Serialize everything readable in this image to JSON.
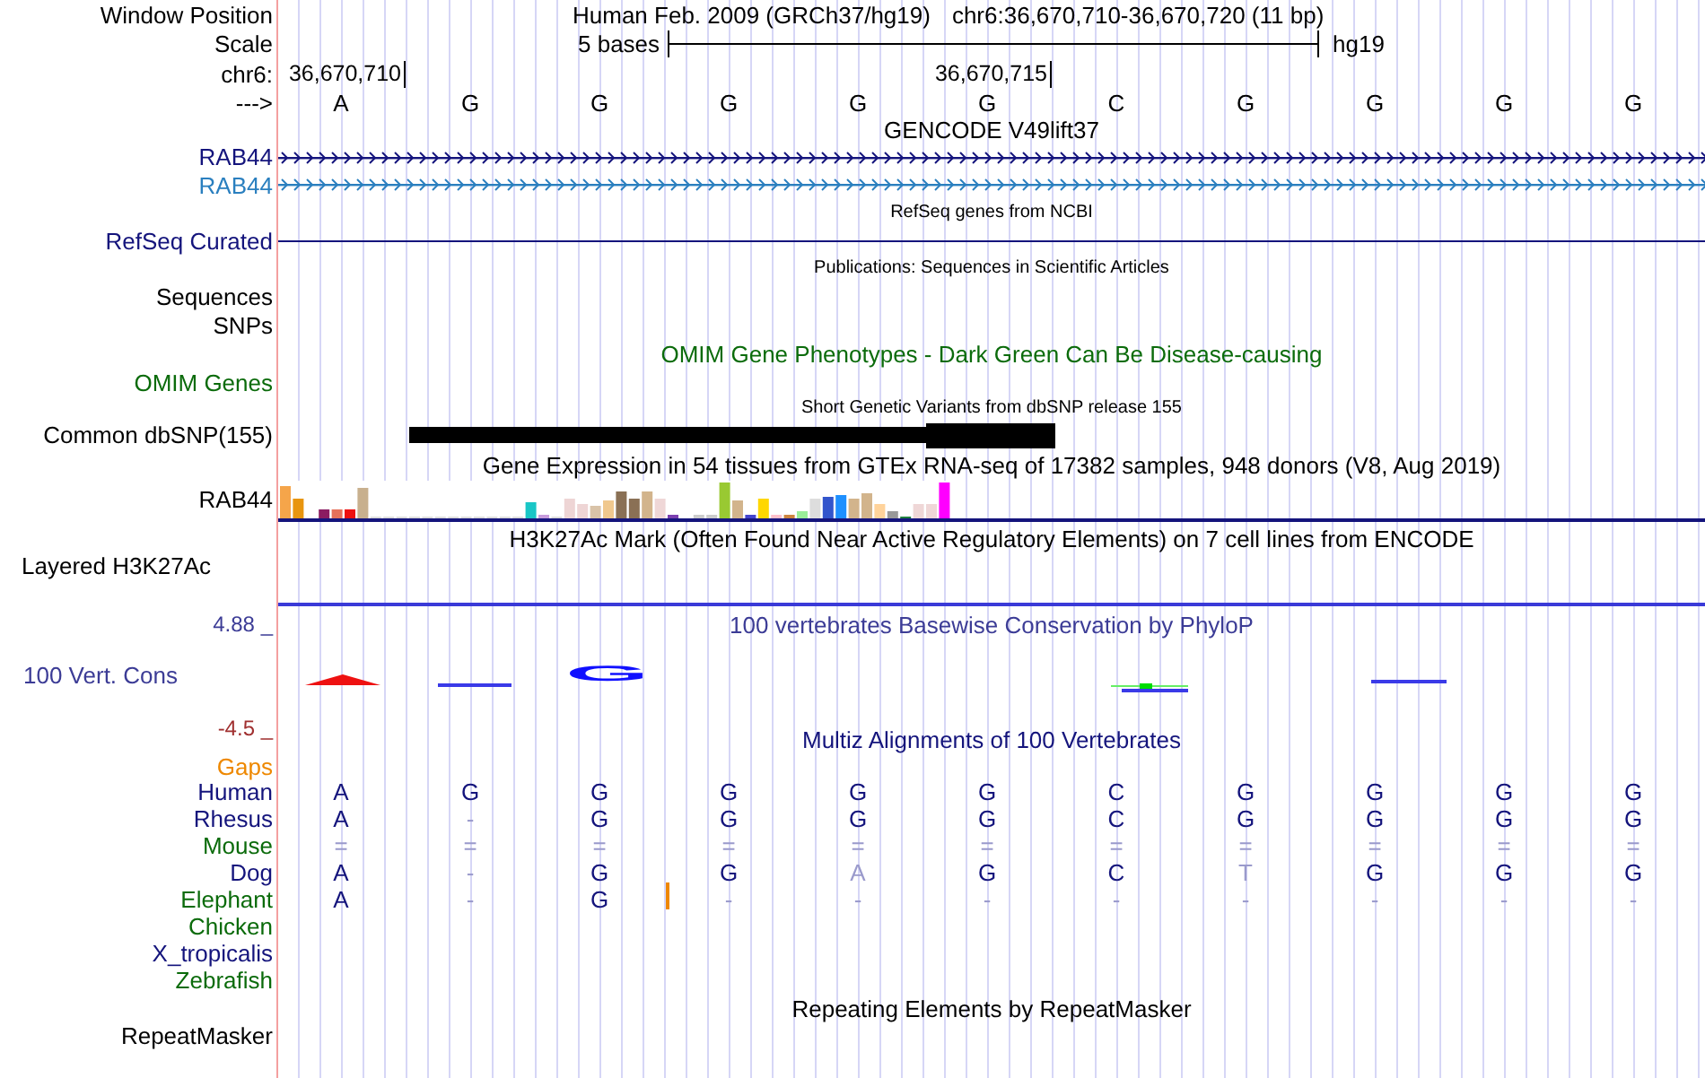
{
  "header": {
    "window_position_label": "Window Position",
    "title": "Human Feb. 2009 (GRCh37/hg19)",
    "position": "chr6:36,670,710-36,670,720 (11 bp)",
    "scale_label": "Scale",
    "scale_text": "5 bases",
    "scale_assembly": "hg19",
    "chrom_label": "chr6:",
    "ticks": [
      "36,670,710",
      "36,670,715"
    ],
    "strand_label": "--->",
    "bases": [
      "A",
      "G",
      "G",
      "G",
      "G",
      "G",
      "C",
      "G",
      "G",
      "G",
      "G"
    ]
  },
  "tracks": [
    {
      "kind": "genes",
      "title": "GENCODE V49lift37",
      "color": "#000000",
      "genes": [
        {
          "label": "RAB44",
          "color": "#14147c"
        },
        {
          "label": "RAB44",
          "color": "#2a7fbf"
        }
      ]
    },
    {
      "kind": "refseq",
      "title": "RefSeq genes from NCBI",
      "color": "#000000",
      "label": "RefSeq Curated",
      "gene_line": {
        "color": "#14147c"
      }
    },
    {
      "kind": "labels",
      "title": "Publications: Sequences in Scientific Articles",
      "color": "#000000",
      "labels": [
        "Sequences",
        "SNPs"
      ]
    },
    {
      "kind": "omim",
      "title": "OMIM Gene Phenotypes - Dark Green Can Be Disease-causing",
      "color": "#0b6b0b",
      "label": "OMIM Genes"
    },
    {
      "kind": "dbsnp",
      "title": "Short Genetic Variants from dbSNP release 155",
      "color": "#000000",
      "label": "Common dbSNP(155)"
    },
    {
      "kind": "gtex",
      "title": "Gene Expression in 54 tissues from GTEx RNA-seq of 17382 samples, 948 donors (V8, Aug 2019)",
      "color": "#000000",
      "label": "RAB44"
    },
    {
      "kind": "h3k27ac",
      "title": "H3K27Ac Mark (Often Found Near Active Regulatory Elements) on 7 cell lines from ENCODE",
      "color": "#000000",
      "label": "Layered H3K27Ac"
    },
    {
      "kind": "phylop",
      "title": "100 vertebrates Basewise Conservation by PhyloP",
      "color": "#3c3c96",
      "label": "100 Vert. Cons",
      "max": "4.88 _",
      "min": "-4.5 _",
      "logo_base": "G"
    },
    {
      "kind": "multiz",
      "title": "Multiz Alignments of 100 Vertebrates",
      "color": "#14147c",
      "gaps_label": "Gaps",
      "species": [
        {
          "name": "Human",
          "color": "#14147c",
          "bases": [
            {
              "text": "A",
              "faded": false,
              "insertion": false
            },
            {
              "text": "G",
              "faded": false,
              "insertion": false
            },
            {
              "text": "G",
              "faded": false,
              "insertion": false
            },
            {
              "text": "G",
              "faded": false,
              "insertion": false
            },
            {
              "text": "G",
              "faded": false,
              "insertion": false
            },
            {
              "text": "G",
              "faded": false,
              "insertion": false
            },
            {
              "text": "C",
              "faded": false,
              "insertion": false
            },
            {
              "text": "G",
              "faded": false,
              "insertion": false
            },
            {
              "text": "G",
              "faded": false,
              "insertion": false
            },
            {
              "text": "G",
              "faded": false,
              "insertion": false
            },
            {
              "text": "G",
              "faded": false,
              "insertion": false
            }
          ]
        },
        {
          "name": "Rhesus",
          "color": "#14147c",
          "bases": [
            {
              "text": "A",
              "faded": false,
              "insertion": false
            },
            {
              "text": "-",
              "faded": true,
              "insertion": false
            },
            {
              "text": "G",
              "faded": false,
              "insertion": false
            },
            {
              "text": "G",
              "faded": false,
              "insertion": false
            },
            {
              "text": "G",
              "faded": false,
              "insertion": false
            },
            {
              "text": "G",
              "faded": false,
              "insertion": false
            },
            {
              "text": "C",
              "faded": false,
              "insertion": false
            },
            {
              "text": "G",
              "faded": false,
              "insertion": false
            },
            {
              "text": "G",
              "faded": false,
              "insertion": false
            },
            {
              "text": "G",
              "faded": false,
              "insertion": false
            },
            {
              "text": "G",
              "faded": false,
              "insertion": false
            }
          ]
        },
        {
          "name": "Mouse",
          "color": "#0b6b0b",
          "bases": [
            {
              "text": "=",
              "faded": true,
              "insertion": false
            },
            {
              "text": "=",
              "faded": true,
              "insertion": false
            },
            {
              "text": "=",
              "faded": true,
              "insertion": false
            },
            {
              "text": "=",
              "faded": true,
              "insertion": false
            },
            {
              "text": "=",
              "faded": true,
              "insertion": false
            },
            {
              "text": "=",
              "faded": true,
              "insertion": false
            },
            {
              "text": "=",
              "faded": true,
              "insertion": false
            },
            {
              "text": "=",
              "faded": true,
              "insertion": false
            },
            {
              "text": "=",
              "faded": true,
              "insertion": false
            },
            {
              "text": "=",
              "faded": true,
              "insertion": false
            },
            {
              "text": "=",
              "faded": true,
              "insertion": false
            }
          ]
        },
        {
          "name": "Dog",
          "color": "#14147c",
          "bases": [
            {
              "text": "A",
              "faded": false,
              "insertion": false
            },
            {
              "text": "-",
              "faded": true,
              "insertion": false
            },
            {
              "text": "G",
              "faded": false,
              "insertion": false
            },
            {
              "text": "G",
              "faded": false,
              "insertion": false
            },
            {
              "text": "A",
              "faded": true,
              "insertion": false
            },
            {
              "text": "G",
              "faded": false,
              "insertion": false
            },
            {
              "text": "C",
              "faded": false,
              "insertion": false
            },
            {
              "text": "T",
              "faded": true,
              "insertion": false
            },
            {
              "text": "G",
              "faded": false,
              "insertion": false
            },
            {
              "text": "G",
              "faded": false,
              "insertion": false
            },
            {
              "text": "G",
              "faded": false,
              "insertion": false
            }
          ]
        },
        {
          "name": "Elephant",
          "color": "#0b6b0b",
          "bases": [
            {
              "text": "A",
              "faded": false,
              "insertion": false
            },
            {
              "text": "-",
              "faded": true,
              "insertion": false
            },
            {
              "text": "G",
              "faded": false,
              "insertion": true
            },
            {
              "text": "-",
              "faded": true,
              "insertion": false
            },
            {
              "text": "-",
              "faded": true,
              "insertion": false
            },
            {
              "text": "-",
              "faded": true,
              "insertion": false
            },
            {
              "text": "-",
              "faded": true,
              "insertion": false
            },
            {
              "text": "-",
              "faded": true,
              "insertion": false
            },
            {
              "text": "-",
              "faded": true,
              "insertion": false
            },
            {
              "text": "-",
              "faded": true,
              "insertion": false
            },
            {
              "text": "-",
              "faded": true,
              "insertion": false
            }
          ]
        },
        {
          "name": "Chicken",
          "color": "#0b6b0b"
        },
        {
          "name": "X_tropicalis",
          "color": "#14147c"
        },
        {
          "name": "Zebrafish",
          "color": "#0b6b0b"
        }
      ]
    },
    {
      "kind": "repeats",
      "title": "Repeating Elements by RepeatMasker",
      "color": "#000000",
      "label": "RepeatMasker"
    }
  ]
}
